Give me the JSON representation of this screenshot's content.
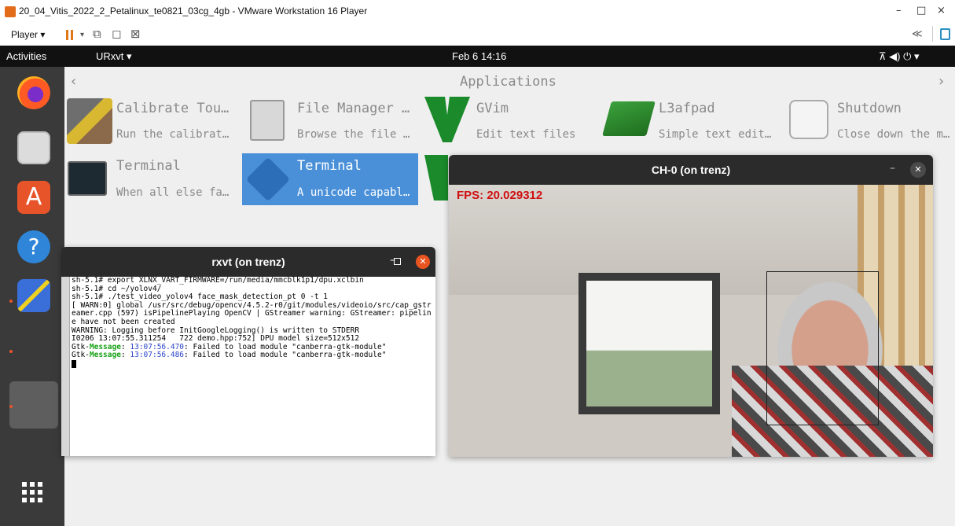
{
  "vmware": {
    "window_title": "20_04_Vitis_2022_2_Petalinux_te0821_03cg_4gb - VMware Workstation 16 Player",
    "minimize": "–",
    "maximize": "□",
    "close": "×",
    "player_menu": "Player ▾",
    "collapse": "≪"
  },
  "topbar": {
    "activities": "Activities",
    "app_menu": "URxvt ▾",
    "clock": "Feb 6  14:16",
    "status_icons": "⊼  ◀)  ⏻  ▾"
  },
  "launcher": {
    "title": "Applications",
    "prev": "‹",
    "next": "›",
    "apps": [
      {
        "name": "Calibrate Tou…",
        "desc": "Run the calibrat…"
      },
      {
        "name": "File Manager …",
        "desc": "Browse the file …"
      },
      {
        "name": "GVim",
        "desc": "Edit text files"
      },
      {
        "name": "L3afpad",
        "desc": "Simple text edit…"
      },
      {
        "name": "Shutdown",
        "desc": "Close down the m…"
      },
      {
        "name": "Terminal",
        "desc": "When all else fa…"
      },
      {
        "name": "Terminal",
        "desc": "A unicode capabl…"
      }
    ]
  },
  "rxvt": {
    "title": "rxvt (on trenz)",
    "lines": [
      "sh-5.1# export XLNX_VART_FIRMWARE=/run/media/mmcblk1p1/dpu.xclbin",
      "sh-5.1# cd ~/yolov4/",
      "sh-5.1# ./test_video_yolov4 face_mask_detection_pt 0 -t 1",
      "[ WARN:0] global /usr/src/debug/opencv/4.5.2-r0/git/modules/videoio/src/cap_gstr",
      "eamer.cpp (597) isPipelinePlaying OpenCV | GStreamer warning: GStreamer: pipelin",
      "e have not been created",
      "WARNING: Logging before InitGoogleLogging() is written to STDERR",
      "I0206 13:07:55.311254   722 demo.hpp:752] DPU model size=512x512"
    ],
    "gtk": [
      {
        "prefix": "Gtk-",
        "tag": "Message",
        "time": "13:07:56.470",
        "msg": ": Failed to load module \"canberra-gtk-module\""
      },
      {
        "prefix": "Gtk-",
        "tag": "Message",
        "time": "13:07:56.486",
        "msg": ": Failed to load module \"canberra-gtk-module\""
      }
    ]
  },
  "camera": {
    "title": "CH-0 (on trenz)",
    "fps_label": "FPS: 20.029312",
    "minimize": "–",
    "close": "✕"
  }
}
